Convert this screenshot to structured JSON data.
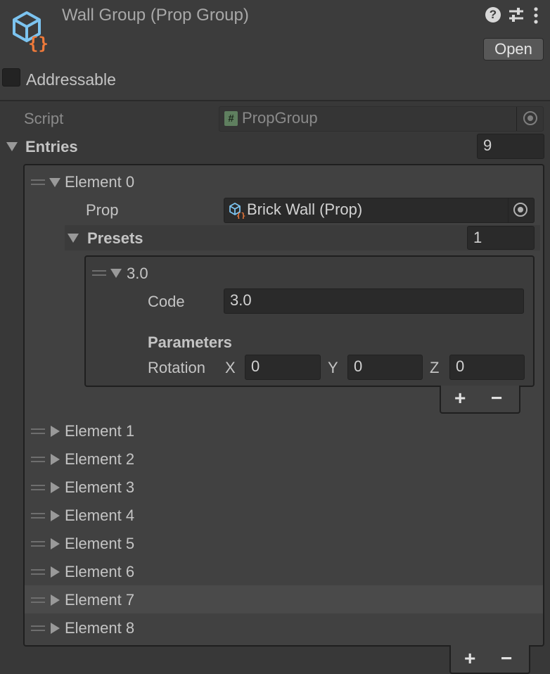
{
  "header": {
    "title": "Wall Group (Prop Group)",
    "open_label": "Open",
    "addressable_label": "Addressable",
    "addressable_checked": false,
    "icons": [
      "prop-group-icon",
      "help-icon",
      "settings-sliders-icon",
      "more-vertical-icon"
    ]
  },
  "script": {
    "label": "Script",
    "value": "PropGroup",
    "icon": "hash-icon"
  },
  "entries": {
    "label": "Entries",
    "count": "9",
    "element0": {
      "label": "Element 0",
      "prop_label": "Prop",
      "prop_value": "Brick Wall (Prop)",
      "presets": {
        "label": "Presets",
        "count": "1",
        "preset0": {
          "label": "3.0",
          "code_label": "Code",
          "code_value": "3.0",
          "parameters_label": "Parameters",
          "rotation_label": "Rotation",
          "x_label": "X",
          "x_value": "0",
          "y_label": "Y",
          "y_value": "0",
          "z_label": "Z",
          "z_value": "0"
        }
      }
    },
    "collapsed_elements": [
      "Element 1",
      "Element 2",
      "Element 3",
      "Element 4",
      "Element 5",
      "Element 6",
      "Element 7",
      "Element 8"
    ],
    "highlighted_element": "Element 7"
  },
  "list_controls": {
    "add": "+",
    "remove": "−"
  },
  "colors": {
    "background": "#383838",
    "field": "#2a2a2a",
    "icon_blue": "#7cc4f0",
    "icon_orange": "#f07a3a"
  }
}
